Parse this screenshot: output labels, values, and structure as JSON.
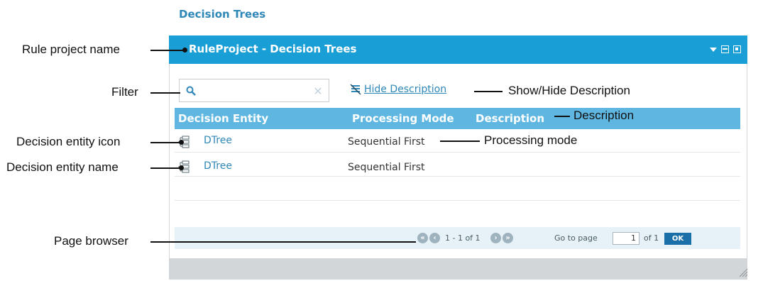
{
  "page": {
    "section_title": "Decision Trees"
  },
  "widget": {
    "title": "RuleProject - Decision Trees"
  },
  "toolbar": {
    "hide_description_label": "Hide Description"
  },
  "table": {
    "columns": [
      "Decision Entity",
      "Processing Mode",
      "Description"
    ],
    "rows": [
      {
        "entity": "DTree",
        "processing_mode": "Sequential First"
      },
      {
        "entity": "DTree",
        "processing_mode": "Sequential First"
      }
    ]
  },
  "pager": {
    "range_text": "1 - 1 of 1",
    "go_to_label": "Go to page",
    "page_value": "1",
    "of_text": "of 1",
    "ok_label": "OK"
  },
  "callouts": {
    "rule_project_name": "Rule project name",
    "filter": "Filter",
    "decision_entity_icon": "Decision entity icon",
    "decision_entity_name": "Decision entity name",
    "page_browser": "Page browser",
    "show_hide_description": "Show/Hide Description",
    "description": "Description",
    "processing_mode": "Processing mode"
  },
  "colors": {
    "header_blue": "#1a9ed6",
    "table_header_blue": "#5fb7e1",
    "link_blue": "#2f87b8",
    "ok_button": "#1a6fa8"
  },
  "icons": {
    "search": "search-icon",
    "clear": "clear-icon",
    "hide_description": "hide-description-icon",
    "entity": "decision-tree-icon",
    "pager_first": "first-page-icon",
    "pager_prev": "previous-page-icon",
    "pager_next": "next-page-icon",
    "pager_last": "last-page-icon"
  }
}
